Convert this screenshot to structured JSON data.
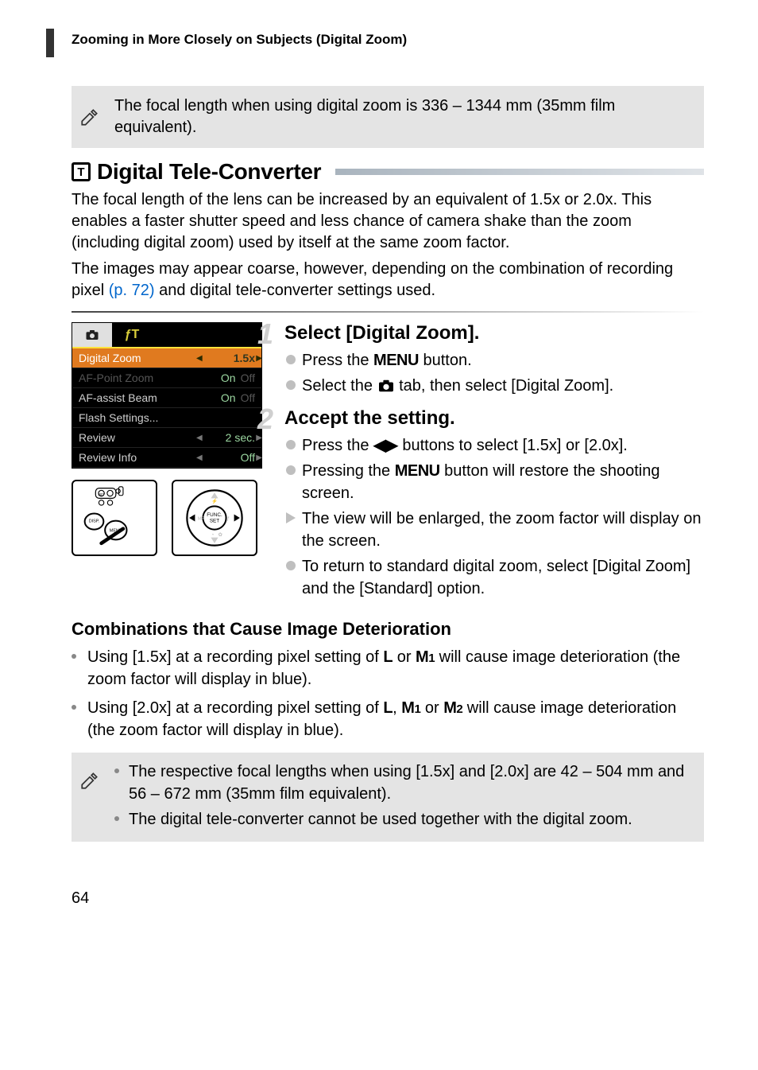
{
  "page_number": "64",
  "section_title_top": "Zooming in More Closely on Subjects (Digital Zoom)",
  "note1_text": "The focal length when using digital zoom is 336 – 1344 mm (35mm film equivalent).",
  "h2_text": "Digital Tele-Converter",
  "h2_badge": "T",
  "body1_a": "The focal length of the lens can be increased by an equivalent of 1.5x or 2.0x. This enables a faster shutter speed and less chance of camera shake than the zoom (including digital zoom) used by itself at the same zoom factor.",
  "body2_a": "The images may appear coarse, however, depending on the combination of recording pixel ",
  "body2_link": "(p. 72)",
  "body2_b": " and digital tele-converter settings used.",
  "menu": {
    "rows": [
      {
        "label": "Digital Zoom",
        "value": "1.5x"
      },
      {
        "label": "AF-Point Zoom",
        "on": "On",
        "off": "Off"
      },
      {
        "label": "AF-assist Beam",
        "on": "On",
        "off": "Off"
      },
      {
        "label": "Flash Settings...",
        "value": ""
      },
      {
        "label": "Review",
        "value": "2 sec."
      },
      {
        "label": "Review Info",
        "value": "Off"
      }
    ]
  },
  "step1_title": "Select [Digital Zoom].",
  "step1_b1_a": "Press the ",
  "step1_b1_b": " button.",
  "step1_b2_a": "Select the ",
  "step1_b2_b": " tab, then select [Digital Zoom].",
  "step2_title": "Accept the setting.",
  "step2_b1_a": "Press the ",
  "step2_b1_b": " buttons to select [1.5x] or [2.0x].",
  "step2_b2_a": "Pressing the ",
  "step2_b2_b": " button will restore the shooting screen.",
  "step2_b3": "The view will be enlarged, the zoom factor will display on the screen.",
  "step2_b4": "To return to standard digital zoom, select [Digital Zoom] and the [Standard] option.",
  "h4": "Combinations that Cause Image Deterioration",
  "cb1_a": "Using [1.5x] at a recording pixel setting of ",
  "cb1_b": " or ",
  "cb1_c": " will cause image deterioration (the zoom factor will display in blue).",
  "cb2_a": "Using [2.0x] at a recording pixel setting of ",
  "cb2_b": ", ",
  "cb2_c": " or ",
  "cb2_d": " will cause image deterioration (the zoom factor will display in blue).",
  "note2_a": "The respective focal lengths when using [1.5x] and [2.0x] are 42 – 504 mm and 56 – 672 mm (35mm film equivalent).",
  "note2_b": "The digital tele-converter cannot be used together with the digital zoom.",
  "labels": {
    "menu_word": "MENU",
    "L": "L",
    "M1a": "M",
    "M1b": "1",
    "M2a": "M",
    "M2b": "2"
  }
}
